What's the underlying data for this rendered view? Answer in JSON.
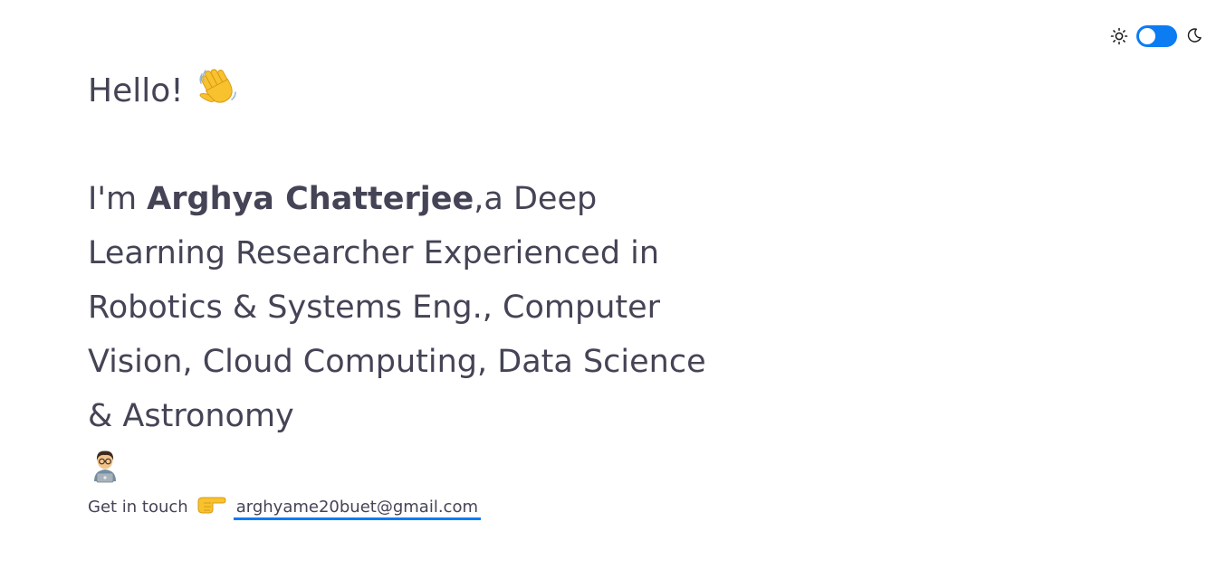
{
  "theme_toggle": {
    "left_icon": "sun-icon",
    "right_icon": "moon-icon",
    "accent_color": "#0b7cf2",
    "state": "light"
  },
  "hero": {
    "greeting": "Hello!",
    "greeting_emoji": "waving-hand-icon",
    "intro_prefix": "I'm ",
    "name": "Arghya Chatterjee",
    "intro_suffix": ",a Deep Learning Researcher Experienced in Robotics & Systems Eng., Computer Vision, Cloud Computing, Data Science & Astronomy",
    "intro_emoji": "technologist-icon"
  },
  "contact": {
    "label": "Get in touch",
    "pointer_emoji": "pointing-right-icon",
    "email": "arghyame20buet@gmail.com",
    "email_href": "mailto:arghyame20buet@gmail.com"
  }
}
